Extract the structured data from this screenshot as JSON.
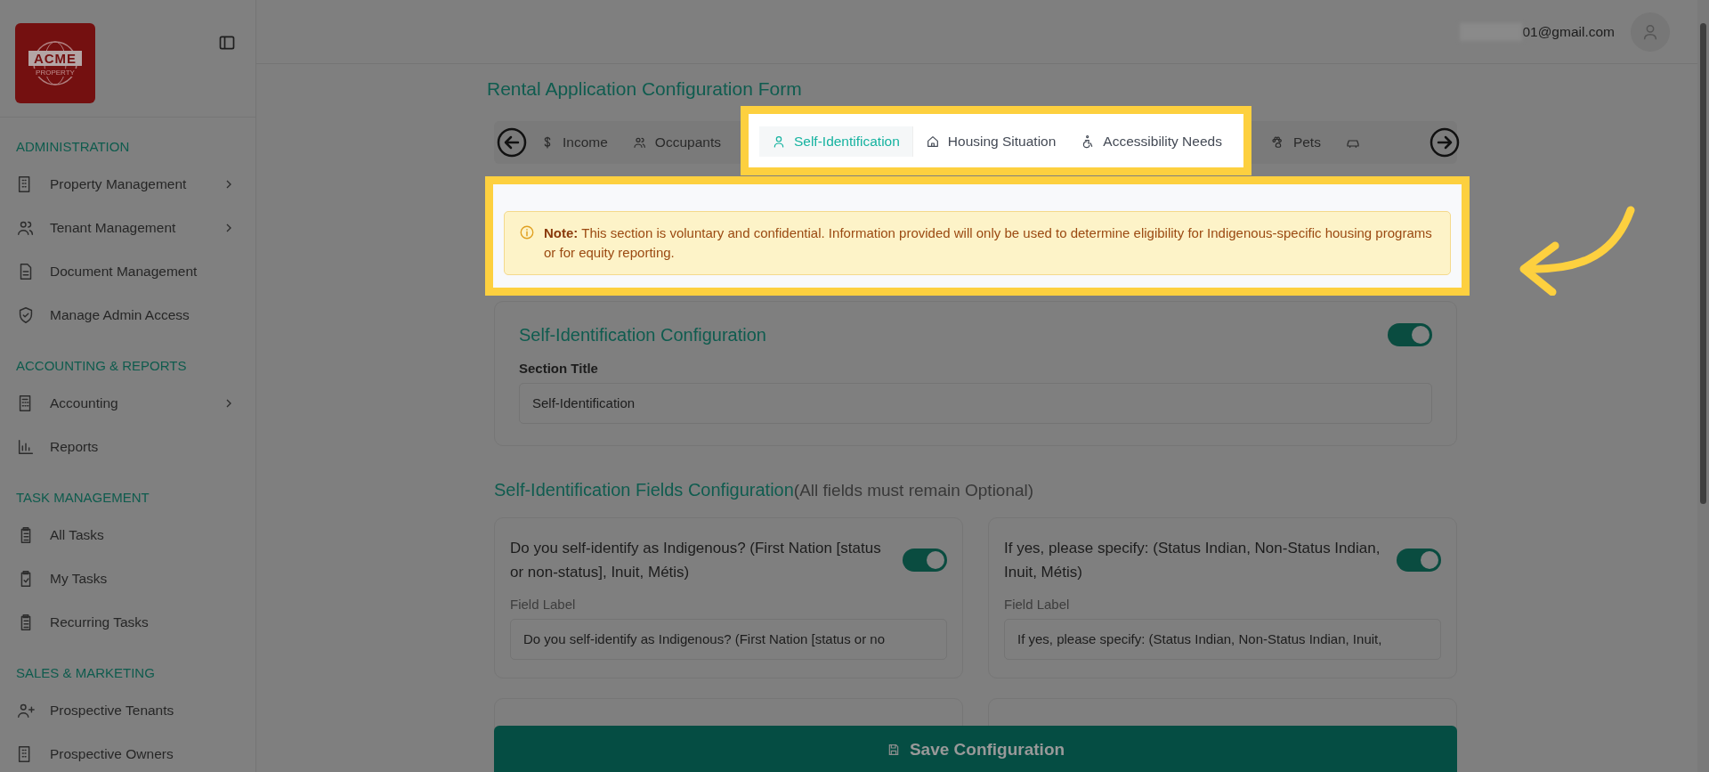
{
  "sidebar": {
    "logo": {
      "text": "ACME",
      "subtext": "PROPERTY"
    },
    "sections": [
      {
        "title": "ADMINISTRATION",
        "items": [
          {
            "label": "Property Management",
            "expandable": true
          },
          {
            "label": "Tenant Management",
            "expandable": true
          },
          {
            "label": "Document Management",
            "expandable": false
          },
          {
            "label": "Manage Admin Access",
            "expandable": false
          }
        ]
      },
      {
        "title": "ACCOUNTING & REPORTS",
        "items": [
          {
            "label": "Accounting",
            "expandable": true
          },
          {
            "label": "Reports",
            "expandable": false
          }
        ]
      },
      {
        "title": "TASK MANAGEMENT",
        "items": [
          {
            "label": "All Tasks",
            "expandable": false
          },
          {
            "label": "My Tasks",
            "expandable": false
          },
          {
            "label": "Recurring Tasks",
            "expandable": false
          }
        ]
      },
      {
        "title": "SALES & MARKETING",
        "items": [
          {
            "label": "Prospective Tenants",
            "expandable": false
          },
          {
            "label": "Prospective Owners",
            "expandable": false
          }
        ]
      }
    ]
  },
  "header": {
    "email": "01@gmail.com"
  },
  "page_title": "Rental Application Configuration Form",
  "tabs": [
    {
      "label": "Income",
      "selected": false,
      "highlighted": false
    },
    {
      "label": "Occupants",
      "selected": false,
      "highlighted": false
    },
    {
      "label": "Self-Identification",
      "selected": true,
      "highlighted": true
    },
    {
      "label": "Housing Situation",
      "selected": false,
      "highlighted": true
    },
    {
      "label": "Accessibility Needs",
      "selected": false,
      "highlighted": true
    },
    {
      "label": "Pets",
      "selected": false,
      "highlighted": false
    },
    {
      "selected": false,
      "highlighted": false
    }
  ],
  "note": {
    "highlighted": true,
    "text": "**Note:** This section is voluntary and confidential. Information provided will only be used to determine eligibility for Indigenous-specific housing programs or for equity reporting."
  },
  "section_config": {
    "title": "Self-Identification Configuration",
    "on": true,
    "field_label": "Section Title",
    "value": "Self-Identification"
  },
  "fields_heading": {
    "title": "Self-Identification Fields Configuration",
    "hint": "(All fields must remain Optional)"
  },
  "fields": [
    {
      "question": "Do you self-identify as Indigenous? (First Nation [status or non-status], Inuit, Métis)",
      "on": true,
      "field_label": "Field Label",
      "value": "Do you self-identify as Indigenous? (First Nation [status or no"
    },
    {
      "question": "If yes, please specify: (Status Indian, Non-Status Indian, Inuit, Métis)",
      "on": true,
      "field_label": "Field Label",
      "value": "If yes, please specify: (Status Indian, Non-Status Indian, Inuit,"
    }
  ],
  "save_button": "Save Configuration"
}
